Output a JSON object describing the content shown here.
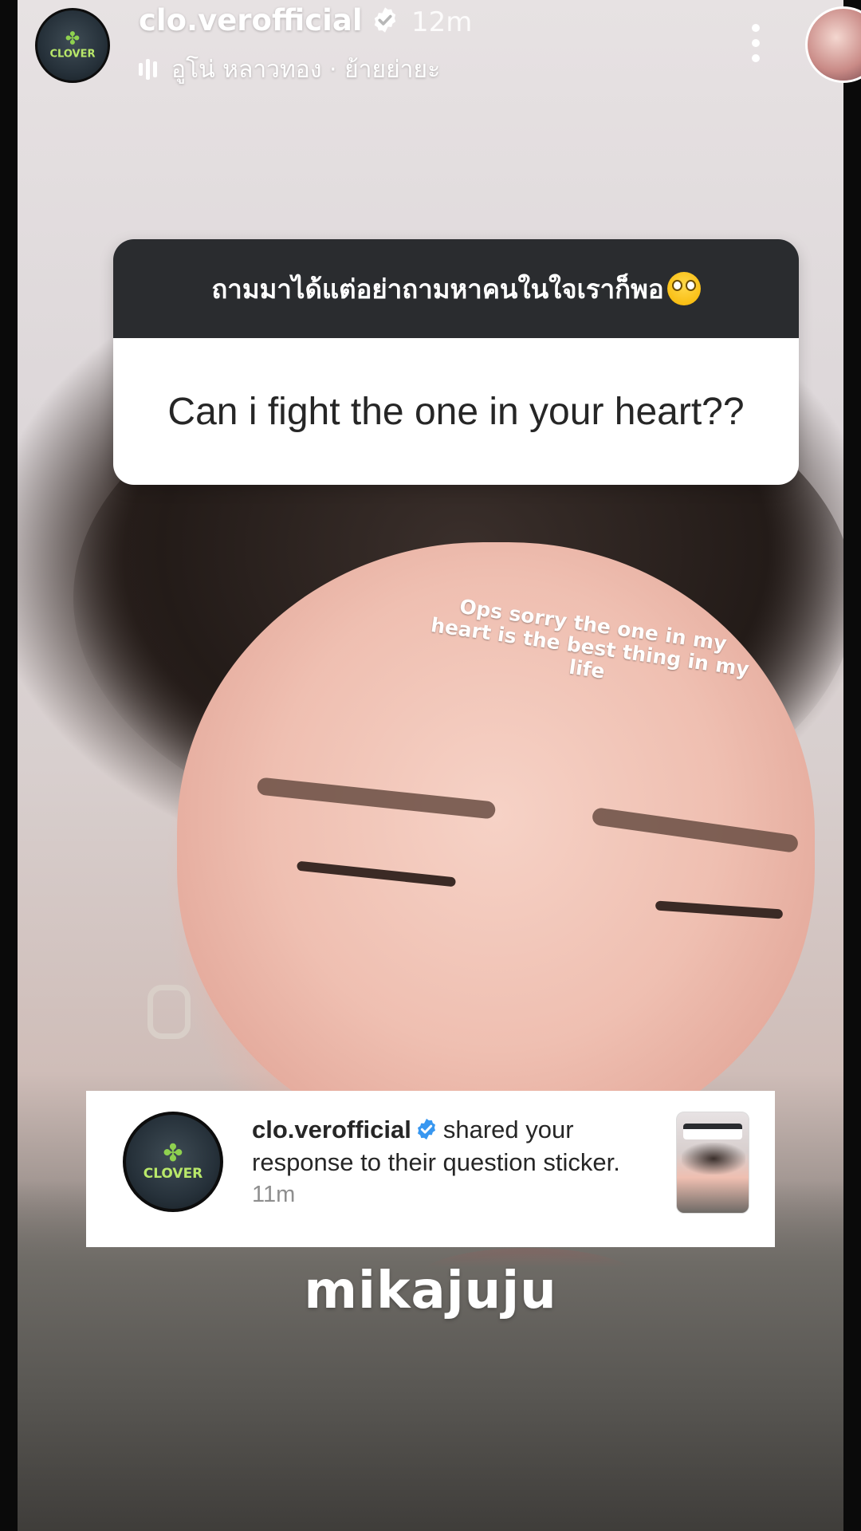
{
  "header": {
    "username": "clo.verofficial",
    "time": "12m",
    "music": "อูโน่ หลาวทอง · ย้ายย่ายะ",
    "avatar_icon": "clover-logo-avatar",
    "avatar_text": "CLOVER"
  },
  "question_sticker": {
    "prompt": "ถามมาได้แต่อย่าถามหาคนในใจเราก็พอ",
    "prompt_emoji": "flushed-face",
    "response": "Can i fight the one in your heart??"
  },
  "overlay_text": "Ops sorry the one in my heart is the best thing in my life",
  "notification": {
    "username": "clo.verofficial",
    "message": "shared your response to their question sticker.",
    "time": "11m",
    "avatar_text": "CLOVER"
  },
  "watermark": "mikajuju",
  "colors": {
    "verified_blue": "#3897f0",
    "sticker_dark": "#2a2c2f",
    "clover_green": "#8fd14f"
  }
}
